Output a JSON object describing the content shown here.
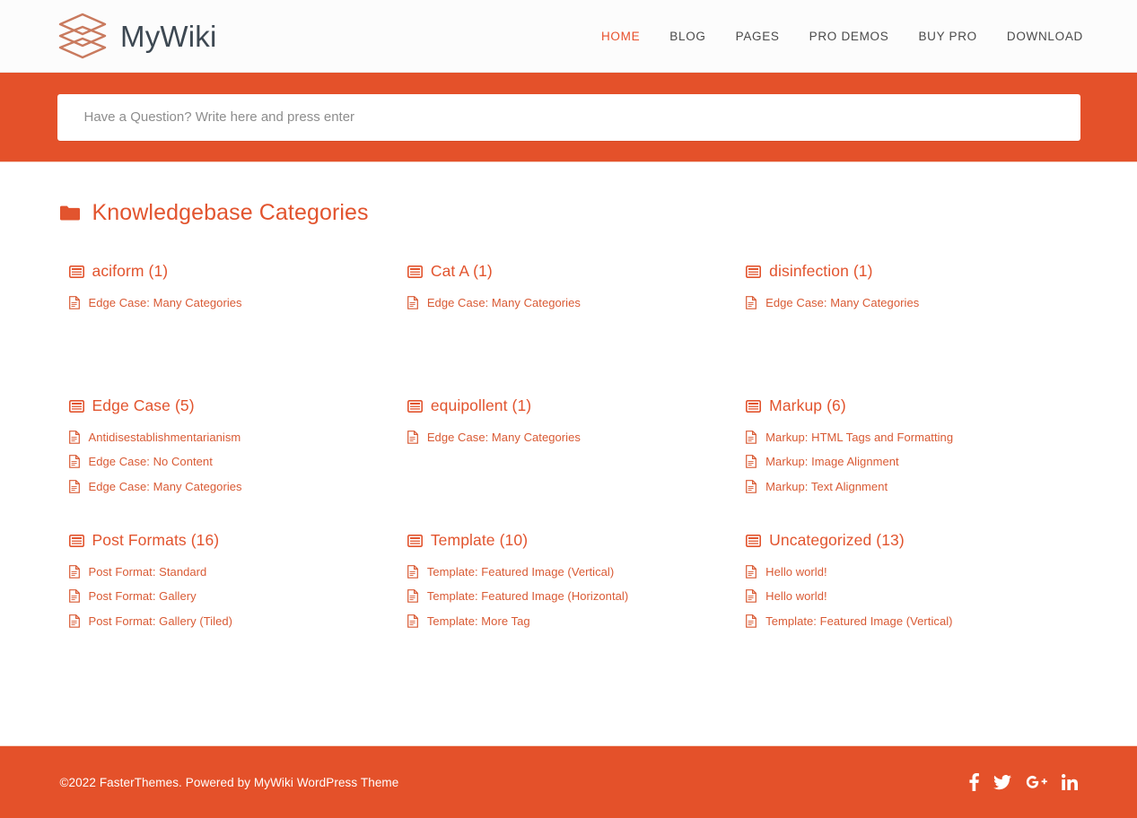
{
  "header": {
    "brand_name": "MyWiki",
    "logo_icon": "stacked-layers-icon",
    "nav": [
      {
        "label": "HOME",
        "active": true
      },
      {
        "label": "BLOG",
        "active": false
      },
      {
        "label": "PAGES",
        "active": false
      },
      {
        "label": "PRO DEMOS",
        "active": false
      },
      {
        "label": "BUY PRO",
        "active": false
      },
      {
        "label": "DOWNLOAD",
        "active": false
      }
    ]
  },
  "search": {
    "placeholder": "Have a Question? Write here and press enter",
    "value": ""
  },
  "main": {
    "section_title": "Knowledgebase Categories",
    "section_icon": "folder-icon",
    "category_icon": "list-box-icon",
    "post_icon": "document-icon",
    "categories": [
      {
        "title": "aciform (1)",
        "posts": [
          "Edge Case: Many Categories"
        ]
      },
      {
        "title": "Cat A (1)",
        "posts": [
          "Edge Case: Many Categories"
        ]
      },
      {
        "title": "disinfection (1)",
        "posts": [
          "Edge Case: Many Categories"
        ]
      },
      {
        "title": "Edge Case (5)",
        "posts": [
          "Antidisestablishmentarianism",
          "Edge Case: No Content",
          "Edge Case: Many Categories"
        ]
      },
      {
        "title": "equipollent (1)",
        "posts": [
          "Edge Case: Many Categories"
        ]
      },
      {
        "title": "Markup (6)",
        "posts": [
          "Markup: HTML Tags and Formatting",
          "Markup: Image Alignment",
          "Markup: Text Alignment"
        ]
      },
      {
        "title": "Post Formats (16)",
        "posts": [
          "Post Format: Standard",
          "Post Format: Gallery",
          "Post Format: Gallery (Tiled)"
        ]
      },
      {
        "title": "Template (10)",
        "posts": [
          "Template: Featured Image (Vertical)",
          "Template: Featured Image (Horizontal)",
          "Template: More Tag"
        ]
      },
      {
        "title": "Uncategorized (13)",
        "posts": [
          "Hello world!",
          "Hello world!",
          "Template: Featured Image (Vertical)"
        ]
      }
    ]
  },
  "footer": {
    "copyright": "©2022 FasterThemes. Powered by MyWiki WordPress Theme",
    "social": [
      {
        "name": "facebook-icon"
      },
      {
        "name": "twitter-icon"
      },
      {
        "name": "google-plus-icon"
      },
      {
        "name": "linkedin-icon"
      }
    ]
  },
  "colors": {
    "accent": "#e4512a",
    "accent_text": "#e2542e",
    "post_link": "#d95a34",
    "nav_text": "#4a4a4a",
    "brand_text": "#3d4852",
    "header_bg": "#fcfcfc",
    "body_bg": "#ffffff"
  }
}
